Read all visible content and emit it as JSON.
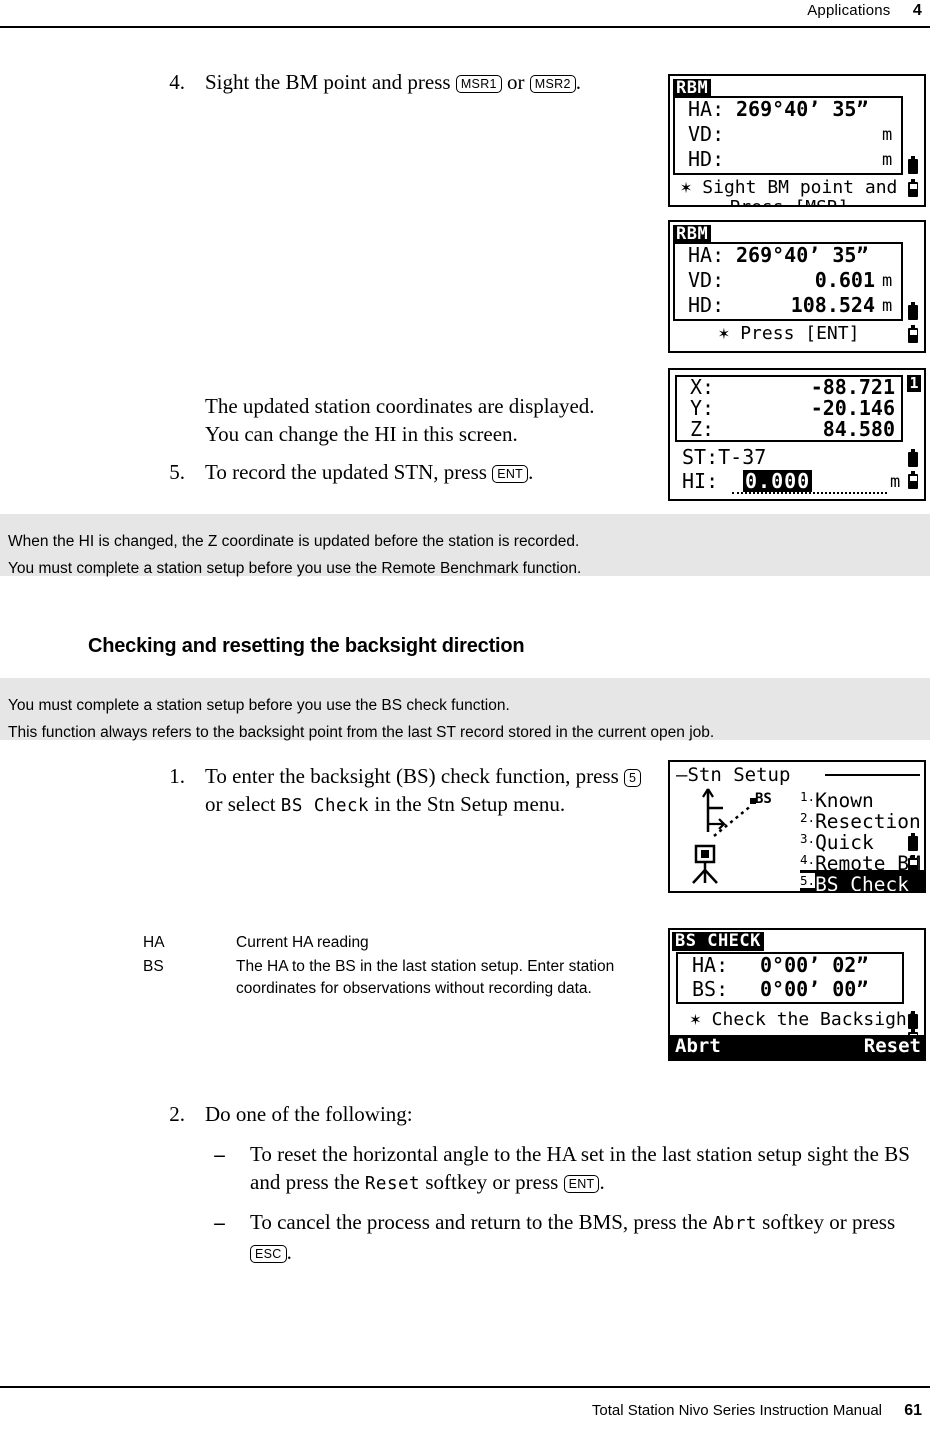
{
  "header": {
    "section": "Applications",
    "chapter": "4"
  },
  "footer": {
    "manual": "Total Station Nivo Series Instruction Manual",
    "page": "61"
  },
  "steps": {
    "step4": {
      "num": "4.",
      "text_before": "Sight the BM point and press ",
      "key1": "MSR1",
      "text_mid": " or ",
      "key2": "MSR2",
      "text_after": "."
    },
    "updated_coords_para": "The updated station coordinates are displayed. You can change the HI in this screen.",
    "step5": {
      "num": "5.",
      "text_before": "To record the updated STN, press ",
      "key1": "ENT",
      "text_after": "."
    },
    "step1": {
      "num": "1.",
      "text_before": "To enter the backsight (BS) check function, press ",
      "key1": "5",
      "text_mid": " or select ",
      "lcd1": "BS  Check",
      "text_after": " in the Stn Setup menu."
    },
    "step2": {
      "num": "2.",
      "text": "Do one of the following:"
    },
    "dash1": {
      "dash": "–",
      "text_before": "To reset the horizontal angle to the HA set in the last station setup sight the BS and press the ",
      "lcd1": "Reset",
      "text_mid": " softkey or press ",
      "key1": "ENT",
      "text_after": "."
    },
    "dash2": {
      "dash": "–",
      "text_before": "To cancel the process and return to the BMS, press the ",
      "lcd1": "Abrt",
      "text_mid": " softkey or press ",
      "key1": "ESC",
      "text_after": "."
    }
  },
  "notes": {
    "note1": {
      "line1": "When the HI is changed, the Z coordinate is updated before the station is recorded.",
      "line2": "You must complete a station setup before you use the Remote Benchmark function."
    },
    "note2": {
      "line1": "You must complete a station setup before you use the BS check function.",
      "line2": "This function always refers to the backsight point from the last ST record stored in the current open job."
    }
  },
  "section_heading": "Checking and resetting the backsight direction",
  "definitions": [
    {
      "term": "HA",
      "desc": "Current HA reading"
    },
    {
      "term": "BS",
      "desc": "The HA to the BS in the last station setup. Enter station coordinates for observations without recording data."
    }
  ],
  "lcd_screens": {
    "rbm_empty": {
      "title": "RBM",
      "rows": [
        {
          "label": "HA:",
          "value": "269°40’ 35”",
          "unit": ""
        },
        {
          "label": "VD:",
          "value": "",
          "unit": "m"
        },
        {
          "label": "HD:",
          "value": "",
          "unit": "m"
        }
      ],
      "message_line1": "✶ Sight BM point and",
      "message_line2": "Press [MSR]"
    },
    "rbm_measured": {
      "title": "RBM",
      "rows": [
        {
          "label": "HA:",
          "value": "269°40’ 35”",
          "unit": ""
        },
        {
          "label": "VD:",
          "value": "0.601",
          "unit": "m"
        },
        {
          "label": "HD:",
          "value": "108.524",
          "unit": "m"
        }
      ],
      "message_line1": "✶ Press [ENT]",
      "message_line2": ""
    },
    "coords": {
      "page_indicator": "1",
      "rows": [
        {
          "label": "X:",
          "value": "-88.721"
        },
        {
          "label": "Y:",
          "value": "-20.146"
        },
        {
          "label": "Z:",
          "value": "84.580"
        }
      ],
      "station_label": "ST:T-37",
      "hi_label": "HI:",
      "hi_value": "0.000",
      "hi_unit": "m"
    },
    "stn_setup": {
      "title": "Stn Setup",
      "diagram_bs_label": "BS",
      "items": [
        {
          "index": "1.",
          "label": "Known",
          "selected": false
        },
        {
          "index": "2.",
          "label": "Resection",
          "selected": false
        },
        {
          "index": "3.",
          "label": "Quick",
          "selected": false
        },
        {
          "index": "4.",
          "label": "Remote BM",
          "selected": false
        },
        {
          "index": "5.",
          "label": "BS Check",
          "selected": true
        }
      ]
    },
    "bs_check": {
      "title": "BS CHECK",
      "rows": [
        {
          "label": "HA:",
          "value": "0°00’ 02”"
        },
        {
          "label": "BS:",
          "value": "0°00’ 00”"
        }
      ],
      "message": "✶ Check the Backsight",
      "softkey_left": "Abrt",
      "softkey_right": "Reset"
    }
  }
}
